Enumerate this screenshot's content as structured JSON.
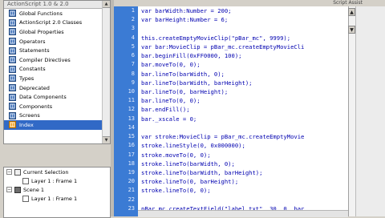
{
  "library": {
    "title": "ActionScript 1.0 & 2.0",
    "items": [
      {
        "label": "Global Functions",
        "selected": false
      },
      {
        "label": "ActionScript 2.0 Classes",
        "selected": false
      },
      {
        "label": "Global Properties",
        "selected": false
      },
      {
        "label": "Operators",
        "selected": false
      },
      {
        "label": "Statements",
        "selected": false
      },
      {
        "label": "Compiler Directives",
        "selected": false
      },
      {
        "label": "Constants",
        "selected": false
      },
      {
        "label": "Types",
        "selected": false
      },
      {
        "label": "Deprecated",
        "selected": false
      },
      {
        "label": "Data Components",
        "selected": false
      },
      {
        "label": "Components",
        "selected": false
      },
      {
        "label": "Screens",
        "selected": false
      },
      {
        "label": "Index",
        "selected": true
      }
    ]
  },
  "outline": {
    "rows": [
      {
        "label": "Current Selection",
        "indent": 0,
        "type": "folder",
        "expander": "−"
      },
      {
        "label": "Layer 1 : Frame 1",
        "indent": 1,
        "type": "layer",
        "expander": ""
      },
      {
        "label": "Scene 1",
        "indent": 0,
        "type": "scene",
        "expander": "−"
      },
      {
        "label": "Layer 1 : Frame 1",
        "indent": 1,
        "type": "layer",
        "expander": ""
      }
    ]
  },
  "toolbar": {
    "assist_label": "Script Assist"
  },
  "editor": {
    "line_numbers": [
      "1",
      "2",
      "3",
      "4",
      "5",
      "6",
      "7",
      "8",
      "9",
      "10",
      "11",
      "12",
      "13",
      "14",
      "15",
      "16",
      "17",
      "18",
      "19",
      "20",
      "21",
      "22",
      "23"
    ],
    "lines": [
      "var barWidth:Number = 200;",
      "var barHeight:Number = 6;",
      "",
      "this.createEmptyMovieClip(\"pBar_mc\", 9999);",
      "var bar:MovieClip = pBar_mc.createEmptyMovieCli",
      "bar.beginFill(0xFF0000, 100);",
      "bar.moveTo(0, 0);",
      "bar.lineTo(barWidth, 0);",
      "bar.lineTo(barWidth, barHeight);",
      "bar.lineTo(0, barHeight);",
      "bar.lineTo(0, 0);",
      "bar.endFill();",
      "bar._xscale = 0;",
      "",
      "var stroke:MovieClip = pBar_mc.createEmptyMovie",
      "stroke.lineStyle(0, 0x000000);",
      "stroke.moveTo(0, 0);",
      "stroke.lineTo(barWidth, 0);",
      "stroke.lineTo(barWidth, barHeight);",
      "stroke.lineTo(0, barHeight);",
      "stroke.lineTo(0, 0);",
      "",
      "pBar_mc.createTextField(\"label_txt\", 30, 0, bar"
    ]
  }
}
